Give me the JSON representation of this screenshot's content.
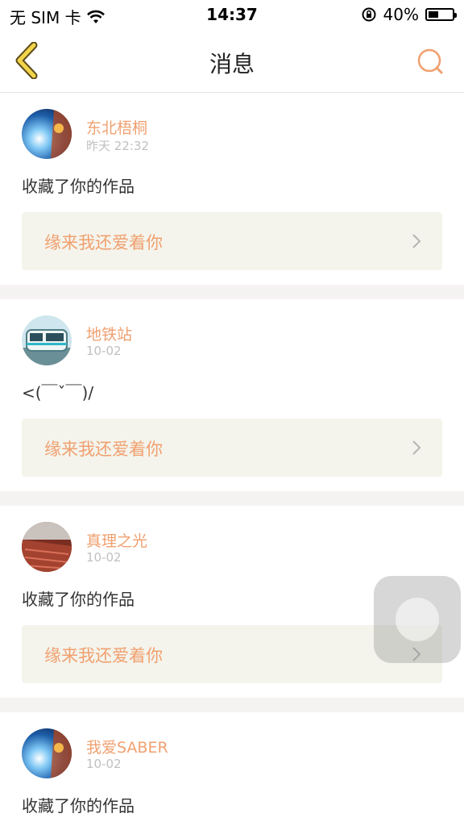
{
  "status_bar": {
    "carrier": "无 SIM 卡",
    "time": "14:37",
    "battery": "40%"
  },
  "nav": {
    "title": "消息",
    "back_icon": "chevron-left-icon",
    "search_icon": "search-icon"
  },
  "colors": {
    "accent": "#f0a070",
    "back": "#e8c233",
    "work_bg": "#f4f4ec"
  },
  "messages": [
    {
      "username": "东北梧桐",
      "time": "昨天 22:32",
      "content": "收藏了你的作品",
      "work_title": "缘来我还爱着你"
    },
    {
      "username": "地铁站",
      "time": "10-02",
      "content": "<(￣ˇ￣)/",
      "work_title": "缘来我还爱着你"
    },
    {
      "username": "真理之光",
      "time": "10-02",
      "content": "收藏了你的作品",
      "work_title": "缘来我还爱着你"
    },
    {
      "username": "我爱SABER",
      "time": "10-02",
      "content": "收藏了你的作品",
      "work_title": ""
    }
  ]
}
